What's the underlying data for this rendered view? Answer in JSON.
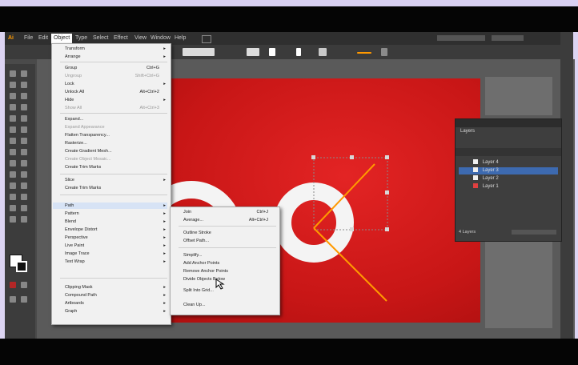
{
  "app": {
    "title": "Adobe Illustrator",
    "colors": {
      "artboard": "#d01b1b",
      "accent": "#ff9900",
      "selection": "#3d6ab0"
    }
  },
  "menubar": {
    "items": [
      "Ai",
      "File",
      "Edit",
      "Object",
      "Type",
      "Select",
      "Effect",
      "View",
      "Window",
      "Help"
    ],
    "active": "Object"
  },
  "object_menu": {
    "items": [
      {
        "label": "Transform",
        "shortcut": "",
        "submenu": true
      },
      {
        "label": "Arrange",
        "shortcut": "",
        "submenu": true
      },
      {
        "label": "Group",
        "shortcut": "Ctrl+G",
        "submenu": false
      },
      {
        "label": "Ungroup",
        "shortcut": "Shift+Ctrl+G",
        "submenu": false,
        "disabled": true
      },
      {
        "label": "Lock",
        "shortcut": "",
        "submenu": true
      },
      {
        "label": "Unlock All",
        "shortcut": "Alt+Ctrl+2",
        "submenu": false
      },
      {
        "label": "Hide",
        "shortcut": "",
        "submenu": true
      },
      {
        "label": "Show All",
        "shortcut": "Alt+Ctrl+3",
        "submenu": false,
        "disabled": true
      },
      {
        "label": "Expand...",
        "shortcut": "",
        "submenu": false
      },
      {
        "label": "Expand Appearance",
        "shortcut": "",
        "submenu": false,
        "disabled": true
      },
      {
        "label": "Flatten Transparency...",
        "shortcut": "",
        "submenu": false
      },
      {
        "label": "Rasterize...",
        "shortcut": "",
        "submenu": false
      },
      {
        "label": "Create Gradient Mesh...",
        "shortcut": "",
        "submenu": false
      },
      {
        "label": "Create Object Mosaic...",
        "shortcut": "",
        "submenu": false,
        "disabled": true
      },
      {
        "label": "Create Trim Marks",
        "shortcut": "",
        "submenu": false
      },
      {
        "label": "Slice",
        "shortcut": "",
        "submenu": true
      },
      {
        "label": "Create Trim Marks",
        "shortcut": "",
        "submenu": false
      },
      {
        "label": "Path",
        "shortcut": "",
        "submenu": true,
        "highlighted": true
      },
      {
        "label": "Pattern",
        "shortcut": "",
        "submenu": true
      },
      {
        "label": "Blend",
        "shortcut": "",
        "submenu": true
      },
      {
        "label": "Envelope Distort",
        "shortcut": "",
        "submenu": true
      },
      {
        "label": "Perspective",
        "shortcut": "",
        "submenu": true
      },
      {
        "label": "Live Paint",
        "shortcut": "",
        "submenu": true
      },
      {
        "label": "Image Trace",
        "shortcut": "",
        "submenu": true
      },
      {
        "label": "Text Wrap",
        "shortcut": "",
        "submenu": true
      },
      {
        "label": "Clipping Mask",
        "shortcut": "",
        "submenu": true
      },
      {
        "label": "Compound Path",
        "shortcut": "",
        "submenu": true
      },
      {
        "label": "Artboards",
        "shortcut": "",
        "submenu": true
      },
      {
        "label": "Graph",
        "shortcut": "",
        "submenu": true
      }
    ]
  },
  "path_submenu": {
    "items": [
      {
        "label": "Join",
        "shortcut": "Ctrl+J"
      },
      {
        "label": "Average...",
        "shortcut": "Alt+Ctrl+J"
      },
      {
        "label": "Outline Stroke",
        "shortcut": ""
      },
      {
        "label": "Offset Path...",
        "shortcut": ""
      },
      {
        "label": "Simplify...",
        "shortcut": ""
      },
      {
        "label": "Add Anchor Points",
        "shortcut": ""
      },
      {
        "label": "Remove Anchor Points",
        "shortcut": ""
      },
      {
        "label": "Divide Objects Below",
        "shortcut": ""
      },
      {
        "label": "Split Into Grid...",
        "shortcut": ""
      },
      {
        "label": "Clean Up...",
        "shortcut": ""
      }
    ]
  },
  "layers_panel": {
    "title": "Layers",
    "layers": [
      {
        "name": "Layer 4",
        "color": "#f0f0f0",
        "selected": false
      },
      {
        "name": "Layer 3",
        "color": "#f0f0f0",
        "selected": true
      },
      {
        "name": "Layer 2",
        "color": "#f0f0f0",
        "selected": false
      },
      {
        "name": "Layer 1",
        "color": "#e04040",
        "selected": false
      }
    ],
    "footer": "4 Layers"
  }
}
